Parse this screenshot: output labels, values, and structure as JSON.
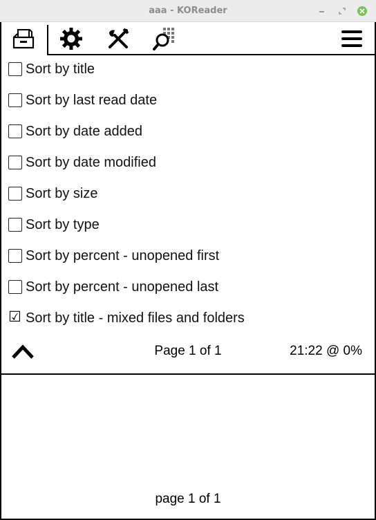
{
  "window": {
    "title": "aaa - KOReader",
    "close_color": "#7cc05b"
  },
  "tabs": [
    {
      "name": "filemanager-tab",
      "icon": "cabinet-icon",
      "selected": true
    },
    {
      "name": "settings-tab",
      "icon": "gear-icon",
      "selected": false
    },
    {
      "name": "tools-tab",
      "icon": "tools-icon",
      "selected": false
    },
    {
      "name": "search-tab",
      "icon": "search-icon",
      "selected": false
    },
    {
      "name": "main-menu-tab",
      "icon": "hamburger-icon",
      "selected": false
    }
  ],
  "menu": {
    "items": [
      {
        "label": "Sort by title",
        "checked": false
      },
      {
        "label": "Sort by last read date",
        "checked": false
      },
      {
        "label": "Sort by date added",
        "checked": false
      },
      {
        "label": "Sort by date modified",
        "checked": false
      },
      {
        "label": "Sort by size",
        "checked": false
      },
      {
        "label": "Sort by type",
        "checked": false
      },
      {
        "label": "Sort by percent - unopened first",
        "checked": false
      },
      {
        "label": "Sort by percent - unopened last",
        "checked": false
      },
      {
        "label": "Sort by title - mixed files and folders",
        "checked": true
      }
    ],
    "check_glyph": "☑",
    "page_info": "Page 1 of 1",
    "time_info": "21:22 @ 0%"
  },
  "browser": {
    "page_info": "page 1 of 1"
  }
}
